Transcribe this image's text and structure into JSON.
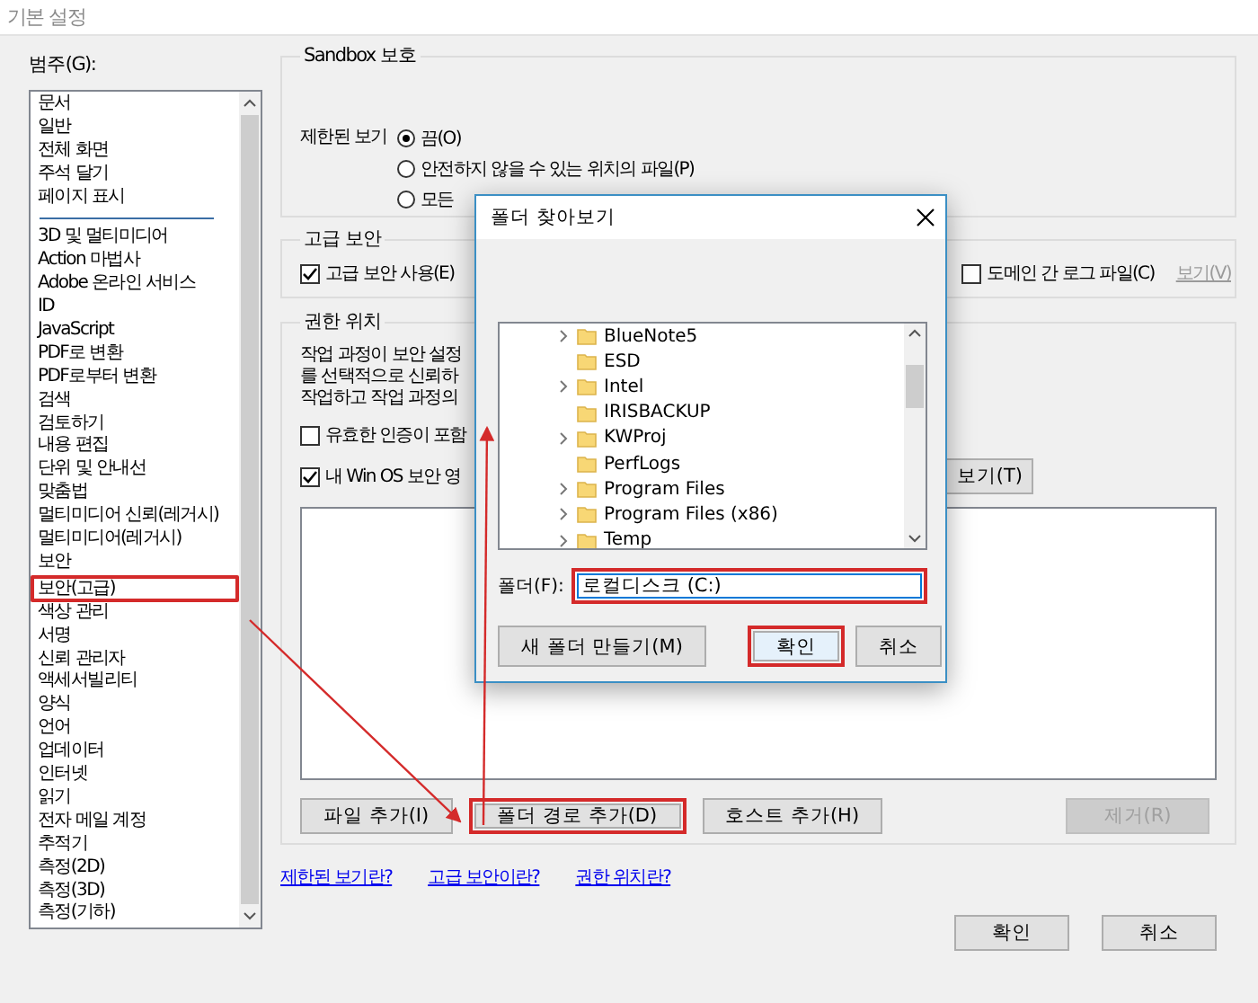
{
  "window": {
    "title": "기본 설정"
  },
  "categories": {
    "label": "범주(G):",
    "groups": [
      {
        "items": [
          {
            "label": "문서",
            "selected": false,
            "highlighted": false
          },
          {
            "label": "일반",
            "selected": false,
            "highlighted": false
          },
          {
            "label": "전체 화면",
            "selected": false,
            "highlighted": false
          },
          {
            "label": "주석 달기",
            "selected": false,
            "highlighted": false
          },
          {
            "label": "페이지 표시",
            "selected": false,
            "highlighted": false
          }
        ]
      },
      {
        "items": [
          {
            "label": "3D 및 멀티미디어",
            "selected": false,
            "highlighted": false
          },
          {
            "label": "Action 마법사",
            "selected": false,
            "highlighted": false
          },
          {
            "label": "Adobe 온라인 서비스",
            "selected": false,
            "highlighted": false
          },
          {
            "label": "ID",
            "selected": false,
            "highlighted": false
          },
          {
            "label": "JavaScript",
            "selected": false,
            "highlighted": false
          },
          {
            "label": "PDF로 변환",
            "selected": false,
            "highlighted": false
          },
          {
            "label": "PDF로부터 변환",
            "selected": false,
            "highlighted": false
          },
          {
            "label": "검색",
            "selected": false,
            "highlighted": false
          },
          {
            "label": "검토하기",
            "selected": false,
            "highlighted": false
          },
          {
            "label": "내용 편집",
            "selected": false,
            "highlighted": false
          },
          {
            "label": "단위 및 안내선",
            "selected": false,
            "highlighted": false
          },
          {
            "label": "맞춤법",
            "selected": false,
            "highlighted": false
          },
          {
            "label": "멀티미디어 신뢰(레거시)",
            "selected": false,
            "highlighted": false
          },
          {
            "label": "멀티미디어(레거시)",
            "selected": false,
            "highlighted": false
          },
          {
            "label": "보안",
            "selected": false,
            "highlighted": false
          },
          {
            "label": "보안(고급)",
            "selected": false,
            "highlighted": true
          },
          {
            "label": "색상 관리",
            "selected": false,
            "highlighted": false
          },
          {
            "label": "서명",
            "selected": false,
            "highlighted": false
          },
          {
            "label": "신뢰 관리자",
            "selected": false,
            "highlighted": false
          },
          {
            "label": "액세서빌리티",
            "selected": false,
            "highlighted": false
          },
          {
            "label": "양식",
            "selected": false,
            "highlighted": false
          },
          {
            "label": "언어",
            "selected": false,
            "highlighted": false
          },
          {
            "label": "업데이터",
            "selected": false,
            "highlighted": false
          },
          {
            "label": "인터넷",
            "selected": false,
            "highlighted": false
          },
          {
            "label": "읽기",
            "selected": false,
            "highlighted": false
          },
          {
            "label": "전자 메일 계정",
            "selected": false,
            "highlighted": false
          },
          {
            "label": "추적기",
            "selected": false,
            "highlighted": false
          },
          {
            "label": "측정(2D)",
            "selected": false,
            "highlighted": false
          },
          {
            "label": "측정(3D)",
            "selected": false,
            "highlighted": false
          },
          {
            "label": "측정(기하)",
            "selected": false,
            "highlighted": false
          }
        ]
      }
    ]
  },
  "sandbox": {
    "title": "Sandbox 보호",
    "label": "제한된 보기",
    "options": [
      {
        "label": "끔(O)",
        "selected": true
      },
      {
        "label": "안전하지 않을 수 있는 위치의 파일(P)",
        "selected": false
      },
      {
        "label": "모든",
        "selected": false
      }
    ]
  },
  "enhanced_security": {
    "title": "고급 보안",
    "enable": {
      "label": "고급 보안 사용(E)",
      "checked": true
    },
    "cross_domain_log": {
      "label": "도메인 간 로그 파일(C)",
      "checked": false
    },
    "view_link": {
      "label": "보기(V)",
      "disabled": true
    }
  },
  "privileged_locations": {
    "title": "권한 위치",
    "description": [
      "작업 과정이 보안 설정",
      "를 선택적으로 신뢰하",
      "작업하고 작업 과정의"
    ],
    "options": [
      {
        "label": "유효한 인증이 포함",
        "checked": false
      },
      {
        "label": "내 Win OS 보안 영",
        "checked": true
      }
    ],
    "view_button": {
      "label": "보기(T)"
    },
    "buttons": [
      {
        "label": "파일 추가(I)",
        "disabled": false,
        "highlighted": false
      },
      {
        "label": "폴더 경로 추가(D)",
        "disabled": false,
        "highlighted": true
      },
      {
        "label": "호스트 추가(H)",
        "disabled": false,
        "highlighted": false
      },
      {
        "label": "제거(R)",
        "disabled": true,
        "highlighted": false
      }
    ]
  },
  "help_links": [
    "제한된 보기란?",
    "고급 보안이란?",
    "권한 위치란?"
  ],
  "buttons": [
    {
      "label": "확인"
    },
    {
      "label": "취소"
    }
  ],
  "folder_dialog": {
    "title": "폴더 찾아보기",
    "tree": [
      {
        "label": "BlueNote5",
        "has_children": true
      },
      {
        "label": "ESD",
        "has_children": false
      },
      {
        "label": "Intel",
        "has_children": true
      },
      {
        "label": "IRISBACKUP",
        "has_children": false
      },
      {
        "label": "KWProj",
        "has_children": true
      },
      {
        "label": "PerfLogs",
        "has_children": false
      },
      {
        "label": "Program Files",
        "has_children": true
      },
      {
        "label": "Program Files (x86)",
        "has_children": true
      },
      {
        "label": "Temp",
        "has_children": true
      }
    ],
    "folder_label": "폴더(F):",
    "folder_value": "로컬디스크 (C:)",
    "folder_highlighted": true,
    "buttons": [
      {
        "label": "새 폴더 만들기(M)",
        "default": false,
        "highlighted": false
      },
      {
        "label": "확인",
        "default": true,
        "highlighted": true
      },
      {
        "label": "취소",
        "default": false,
        "highlighted": false
      }
    ]
  }
}
